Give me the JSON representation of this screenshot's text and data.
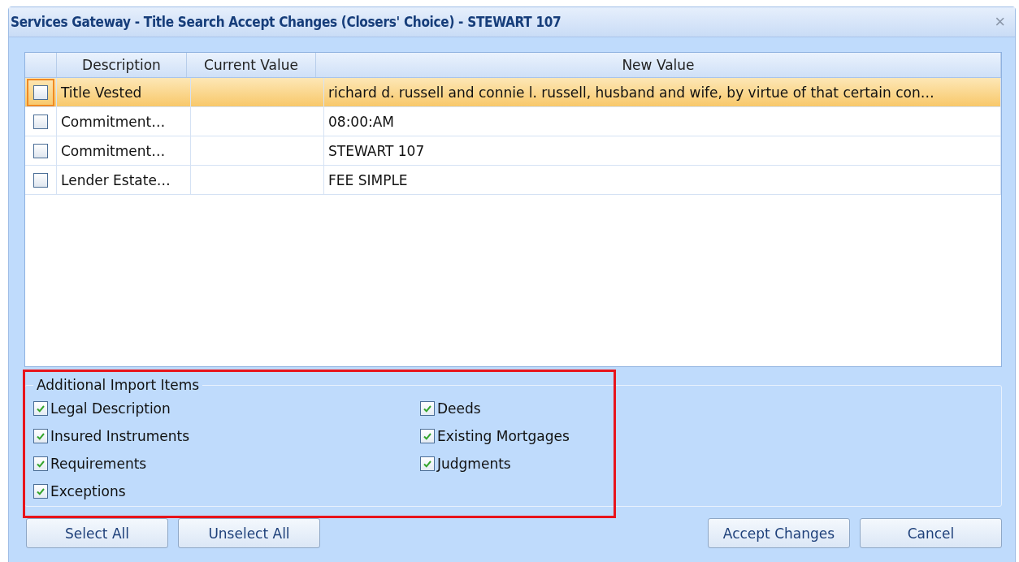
{
  "window": {
    "title": "Services Gateway - Title Search Accept Changes (Closers' Choice) - STEWART 107",
    "close": "×"
  },
  "table": {
    "columns": [
      "Description",
      "Current Value",
      "New Value"
    ],
    "rows": [
      {
        "checked": false,
        "selected": true,
        "description": "Title Vested",
        "current_value": "",
        "new_value": "richard d. russell and connie l. russell, husband and wife, by virtue of that certain con…"
      },
      {
        "checked": false,
        "selected": false,
        "description": "Commitment…",
        "new_value": "08:00:AM"
      },
      {
        "checked": false,
        "selected": false,
        "description": "Commitment…",
        "new_value": "STEWART 107"
      },
      {
        "checked": false,
        "selected": false,
        "description": "Lender Estate…",
        "new_value": "FEE SIMPLE"
      }
    ]
  },
  "import_items": {
    "title": "Additional Import Items",
    "highlighted": true,
    "items": [
      {
        "label": "Legal Description",
        "checked": true
      },
      {
        "label": "Insured Instruments",
        "checked": true
      },
      {
        "label": "Requirements",
        "checked": true
      },
      {
        "label": "Exceptions",
        "checked": true
      },
      {
        "label": "Deeds",
        "checked": true
      },
      {
        "label": "Existing Mortgages",
        "checked": true
      },
      {
        "label": "Judgments",
        "checked": true
      }
    ]
  },
  "buttons_left": [
    "Select All",
    "Unselect All"
  ],
  "buttons_right": [
    "Accept Changes",
    "Cancel"
  ]
}
